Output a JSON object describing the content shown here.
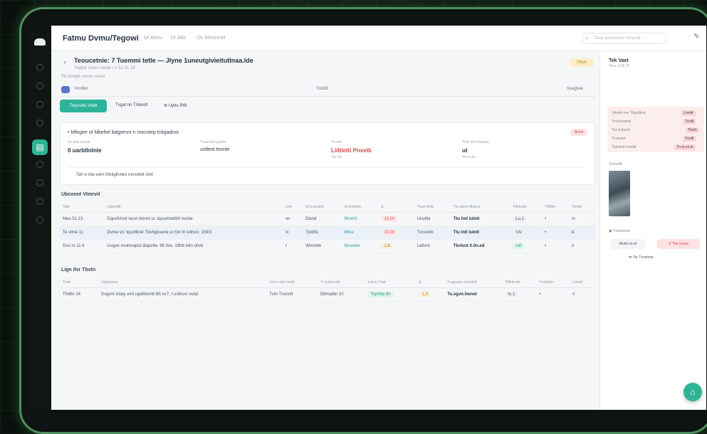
{
  "app": {
    "title": "Fatmu Dvmu/Tegowi",
    "crumbs": [
      "Dr Atmu",
      "Dr Atlo",
      "Dv Atmovnet"
    ]
  },
  "search": {
    "placeholder": "Tauo ascocuotiv mnacoit"
  },
  "header": {
    "back": "‹",
    "title": "Teoucetnie: 7 Tuemmi tetle — Jlyne 1uneutgivieitutlnaa.lde",
    "subtitle": "Tegtpb oraev vmdie r.n 51.01.18",
    "status": "Ottvir",
    "note": "Pb bongle vemio mena"
  },
  "filter": {
    "left": "Vnntfet",
    "mid": "Tcddiit",
    "right": "Svagtvle"
  },
  "tabs": {
    "primary": "Tinpcutiu Vitatt",
    "t2": "Tvgat nn Tnterett",
    "t3": "⟰ Uyttu Plfit"
  },
  "summary": {
    "title": "• Mfegee of Mkefiel ltalgtenni n mecvtep tnligadme",
    "alert": "lilesst",
    "m1": {
      "label": "Tu vtrvt mvate",
      "value": "0 uarbtlnlnle",
      "sub": ""
    },
    "m2": {
      "label": "Tuvat lont gaelts",
      "value": "uvtlent tnvnle",
      "sub": ""
    },
    "m3": {
      "label": "Tu.vtm",
      "value": "Liiltletti Pnvelb",
      "sub": "Tas 00"
    },
    "m4": {
      "label": "Ttvtr Vtvt tneqvto",
      "value": "ut",
      "sub": "Teu lt.do"
    },
    "footnote": "Tah e inte vern thtnlgihvtex mnvetelt vtvit"
  },
  "table1": {
    "title": "Ubconnt Vtmrvit",
    "headers": [
      "Tattt",
      "Lttgteitttt",
      "Lnvt",
      "Ut tnuuvtbtt",
      "Ut tvnotttm",
      "&",
      "Ttuet tlmte",
      "Tm tutme Mutevl",
      "Tttnfutlte",
      "Tfttttlte",
      "Tnntlle"
    ],
    "rows": [
      [
        "Meu 51.13",
        "Dquvfvinnt ieuvt nlenvt ur. tqvuvtnetlttri nvnite",
        "vn",
        "Dtulol",
        "Mne01",
        "10,00",
        "Unutlte",
        "Ttu tntl tulnlt",
        "Lu.1",
        "•",
        "m"
      ],
      [
        "Te vtme 11",
        "Dvme vn: tquvtttrwr Tbvhgvuene ur hnr In ivlinvo: 1h9/3",
        "vi",
        "Tjvtt61",
        "Mtne",
        "10,00",
        "Tvnvotm",
        "Tlu tntl tulnlt",
        "Ulv",
        "•",
        "iii"
      ],
      [
        "Dvo nr 11 6",
        "Uvgoe vnulnvaput dtapvlte. 9h itve, 19htt ivlin ohvtt",
        "ℓ",
        "Wtvnrtle",
        "Mnvvlee",
        "1,8",
        "Lettvnt",
        "Tkvlvut tl.0n.ed",
        "Lt0",
        "•",
        "ri"
      ]
    ],
    "highlight": 1
  },
  "table2": {
    "title": "Lign Ilvr Tbvtn",
    "headers": [
      "Tuntt",
      "Lttgtetatue",
      "Lnnt-Lvtnl rnmtlt",
      "Tn.iytvnvntie",
      "Lvtvnt-Tmtt",
      "&",
      "Tuvgueve tnvrntnlt",
      "Tltlinfvnte",
      "Tmntlv0n",
      "Ldnnd"
    ],
    "rows": [
      [
        "Tfvtttn 14",
        "Dvgvnt lvtaty vnrt ugdtlnvnitt Bh tv/7, t ucthuvr ovtat",
        "Tvtn Tnvnntt",
        "Dttmatbn 10",
        "Ttyvhta 9n",
        "1,0",
        "Tu.vgvn.hwnet",
        "Iu 1",
        "•",
        "il"
      ]
    ]
  },
  "side": {
    "title": "Tek Vaet",
    "subtitle": "Teuv 1116 76",
    "panel": {
      "r1l": "Vttvivtt vnn Tttgvdtnvt",
      "r1v": "Lnmtlt",
      "r2l": "Tnvnvtvatne",
      "r2v": "Tnntll",
      "r3l": "Tnt nvtlvvnt",
      "r3v": "Ttmt1",
      "r4l": "Tnunvtvt",
      "r4v": "Tnntlt",
      "r5l": "Tutvinnlt tvnutiit",
      "r5v": "Tn.nt.nn.tn"
    },
    "photo_label": "Tvnlvvtlt",
    "section_label": "▣ Tvtuvtnnnt",
    "btn1": "Mvtvt vn.nt",
    "btn2": "⚲ Tbe Uvnre",
    "link": "⇄ Tbr Tnvntvnti"
  },
  "fab": "⌂"
}
